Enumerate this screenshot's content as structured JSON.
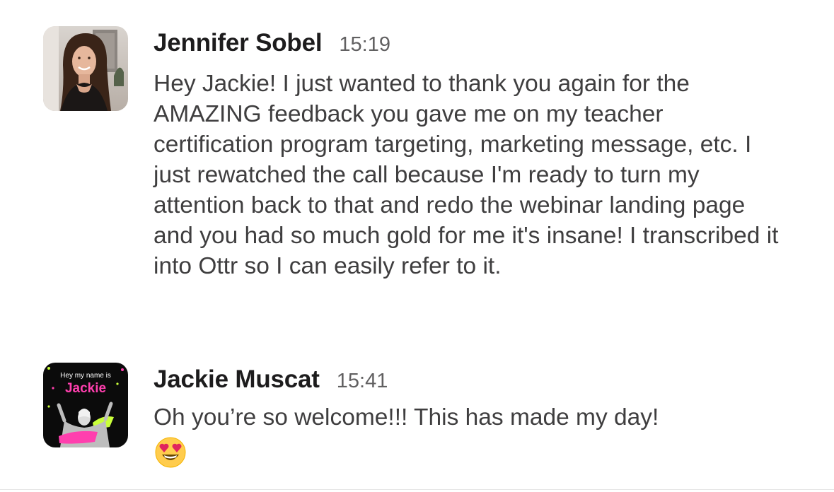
{
  "messages": [
    {
      "sender": "Jennifer Sobel",
      "time": "15:19",
      "text": "Hey Jackie! I just wanted to thank you again for the AMAZING feedback you gave me on my teacher certification program targeting, marketing message, etc. I just rewatched the call because I'm ready to turn my attention back to that and redo the webinar landing page and you had so much gold for me it's insane! I transcribed it into Ottr so I can easily refer to it."
    },
    {
      "sender": "Jackie Muscat",
      "time": "15:41",
      "text": "Oh you’re so welcome!!! This has made my day!",
      "emoji": "heart-eyes-emoji",
      "avatar_text": {
        "small": "Hey my name is",
        "big": "Jackie"
      }
    }
  ],
  "colors": {
    "sender": "#1d1c1d",
    "time": "#616061",
    "text": "#3f3e3f",
    "avatar2_bg": "#0b0b0b",
    "avatar2_accent": "#ff3fae"
  }
}
